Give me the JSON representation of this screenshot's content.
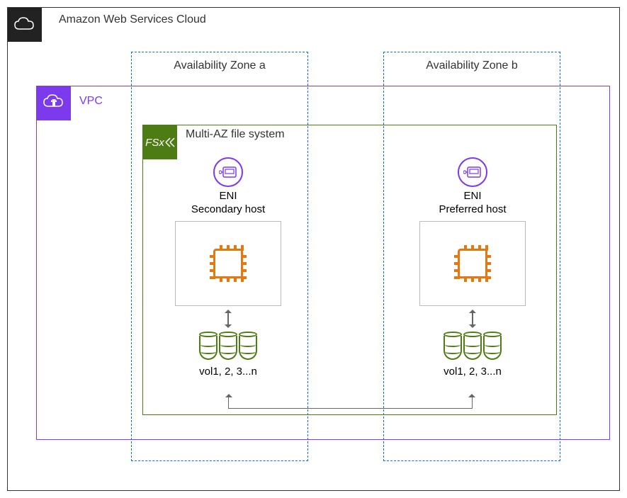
{
  "cloud": {
    "label": "Amazon Web Services Cloud"
  },
  "vpc": {
    "label": "VPC"
  },
  "az": {
    "a": "Availability Zone a",
    "b": "Availability Zone b"
  },
  "fsx": {
    "label": "Multi-AZ file system",
    "badge": "FSx"
  },
  "eni": {
    "label": "ENI"
  },
  "hosts": {
    "secondary": "Secondary host",
    "preferred": "Preferred host"
  },
  "volumes": {
    "label": "vol1, 2, 3...n"
  }
}
